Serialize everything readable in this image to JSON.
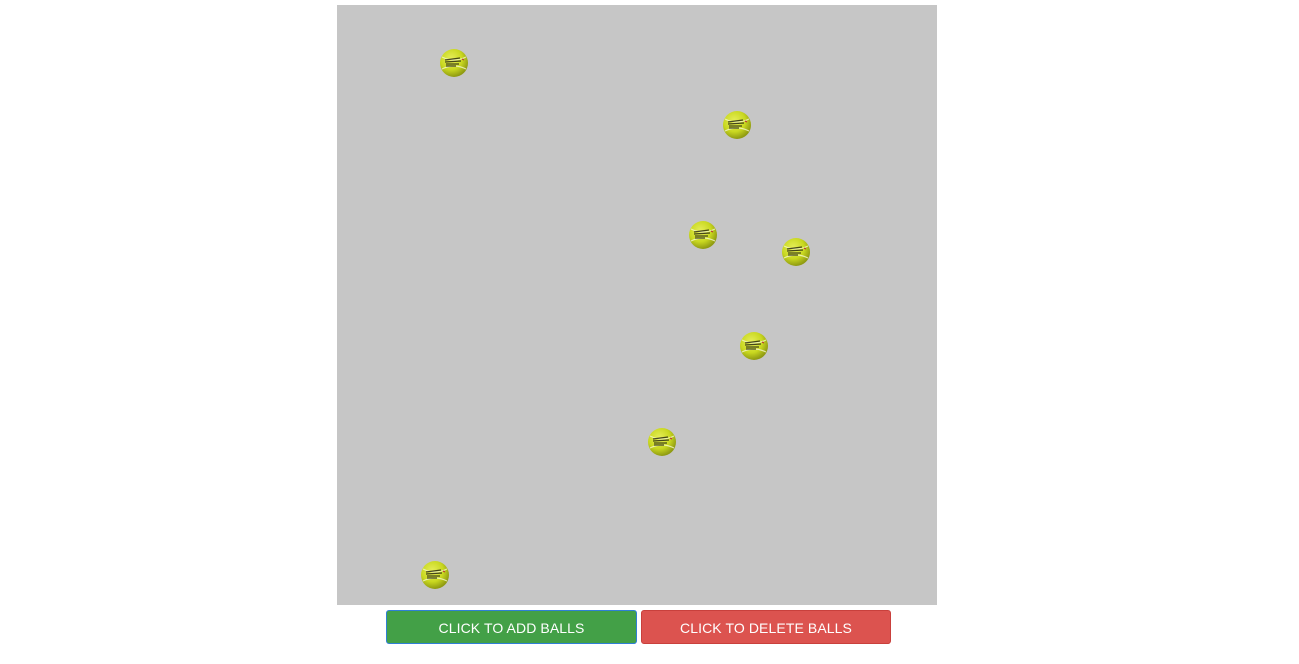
{
  "game": {
    "ball_count": 7,
    "ball_icon": "tennis-ball-icon",
    "ball_color": "#c9d820",
    "canvas_color": "#c6c6c6"
  },
  "controls": {
    "add_label": "CLICK TO ADD BALLS",
    "delete_label": "CLICK TO DELETE BALLS",
    "add_color": "#43a047",
    "delete_color": "#dc534f"
  }
}
